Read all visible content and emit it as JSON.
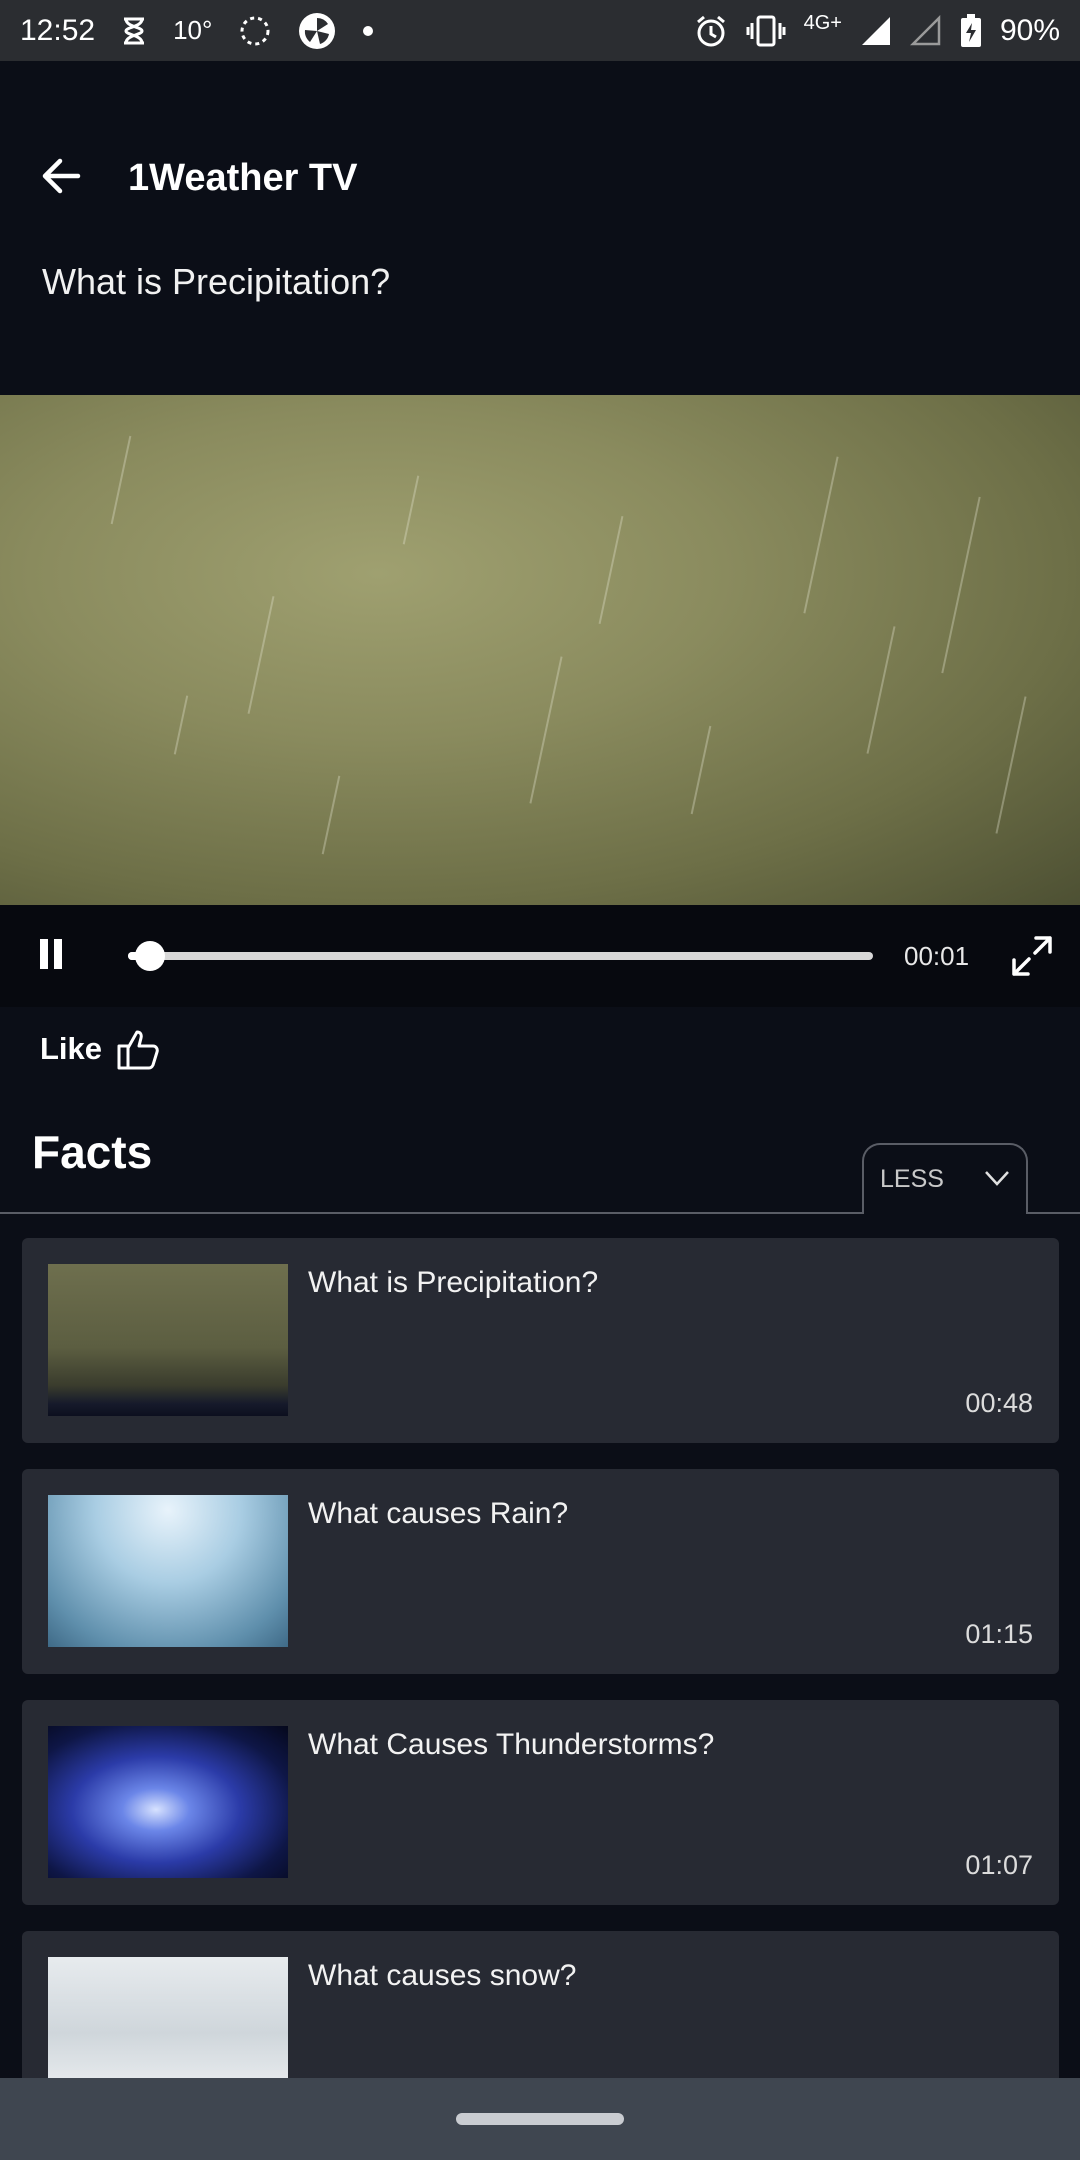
{
  "status_bar": {
    "time": "12:52",
    "temperature": "10°",
    "network": "4G+",
    "battery": "90%",
    "icons": [
      "hourglass-icon",
      "loader-icon",
      "camera-aperture-icon",
      "dot-icon",
      "alarm-icon",
      "vibrate-icon",
      "signal-icon",
      "signal-empty-icon",
      "battery-charging-icon"
    ]
  },
  "header": {
    "app_title": "1Weather TV",
    "video_title": "What is Precipitation?"
  },
  "player": {
    "current_time": "00:01",
    "progress": 0.03,
    "state": "playing"
  },
  "actions": {
    "like_label": "Like"
  },
  "facts": {
    "section_title": "Facts",
    "toggle_label": "LESS",
    "items": [
      {
        "title": "What is Precipitation?",
        "duration": "00:48"
      },
      {
        "title": "What causes Rain?",
        "duration": "01:15"
      },
      {
        "title": "What Causes Thunderstorms?",
        "duration": "01:07"
      },
      {
        "title": "What causes snow?",
        "duration": ""
      }
    ]
  },
  "colors": {
    "background": "#0b0e17",
    "card": "#272a33",
    "status_bar": "#2b2d31",
    "nav_bar": "#3f4650"
  }
}
